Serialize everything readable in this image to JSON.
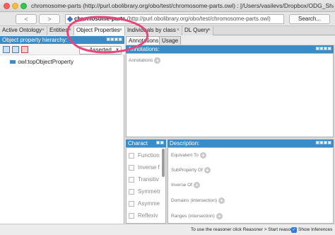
{
  "window": {
    "title": "chromosome-parts (http://purl.obolibrary.org/obo/test/chromosome-parts.owl) : [/Users/vasilevs/Dropbox/ODG_Shared_Folder/..."
  },
  "toolbar": {
    "back_label": "<",
    "forward_label": ">",
    "iri_name": "chromosome-parts",
    "iri_rest": " (http://purl.obolibrary.org/obo/test/chromosome-parts.owl)",
    "search_label": "Search..."
  },
  "tabs": [
    {
      "label": "Active Ontology",
      "close": "×"
    },
    {
      "label": "Entities",
      "close": "×"
    },
    {
      "label": "Object Properties",
      "close": "×"
    },
    {
      "label": "Individuals by class",
      "close": "×"
    },
    {
      "label": "DL Query",
      "close": "×"
    }
  ],
  "left_panel": {
    "header": "Object property hierarchy:",
    "header_controls": "▣▣▣▣",
    "mode": "Asserted",
    "tree_root": "owl:topObjectProperty"
  },
  "right_tabs": [
    "Annotations",
    "Usage"
  ],
  "annotations_panel": {
    "header": "Annotations:",
    "header_controls": "▣▣▣▣",
    "row_label": "Annotations"
  },
  "characteristics_panel": {
    "header": "Charact",
    "header_controls": "▣▣",
    "items": [
      "Function",
      "Inverse f",
      "Transitiv",
      "Symmetr",
      "Asymme",
      "Reflexiv"
    ]
  },
  "description_panel": {
    "header": "Description:",
    "header_controls": "▣▣▣▣",
    "rows": [
      "Equivalent To",
      "SubProperty Of",
      "Inverse Of",
      "Domains (intersection)",
      "Ranges (intersection)"
    ]
  },
  "status": {
    "message": "To use the reasoner click Reasoner > Start reasoner",
    "show_inferences": "Show Inferences"
  },
  "colors": {
    "panel_header": "#3a8cc8",
    "annotation_stroke": "#e8457c"
  }
}
